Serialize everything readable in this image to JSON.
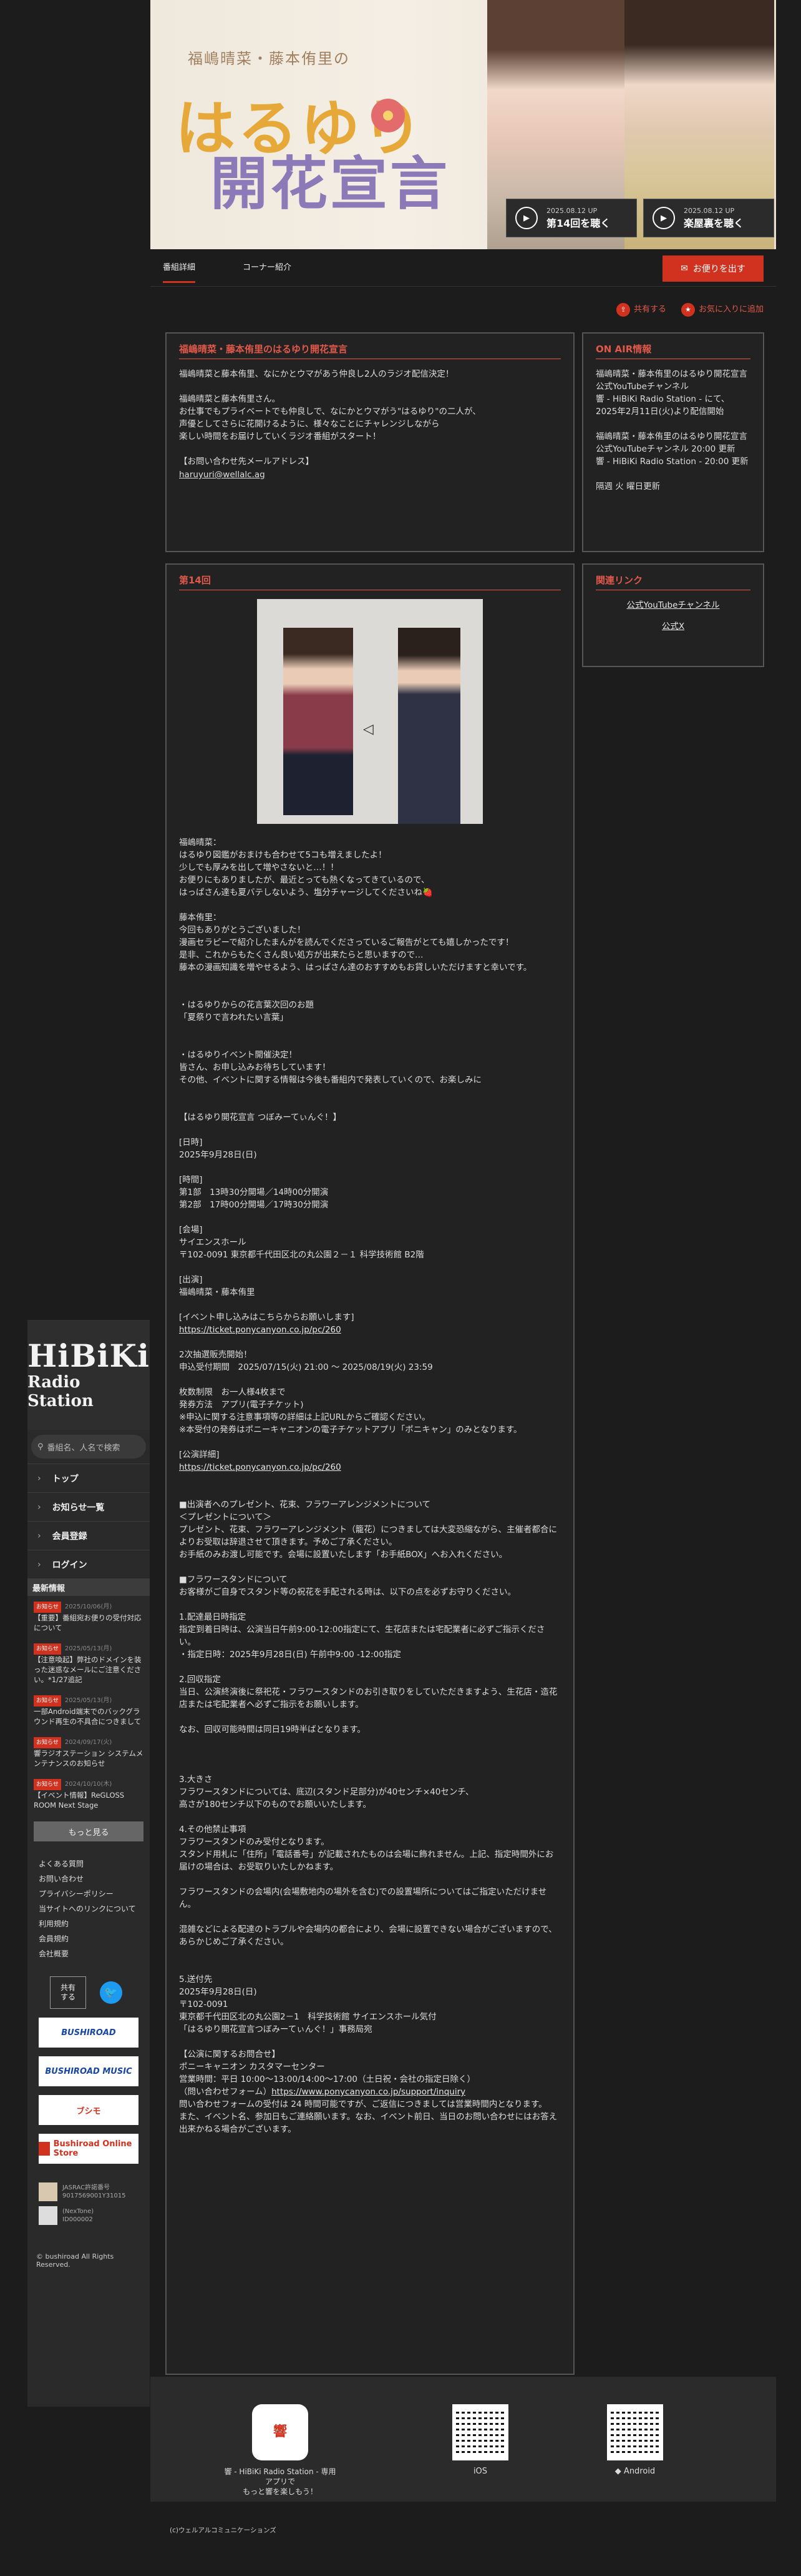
{
  "sidebar": {
    "logo_line1": "HiBiKi",
    "logo_line2": "Radio Station",
    "search_placeholder": "番組名、人名で検索",
    "nav": [
      {
        "label": "トップ"
      },
      {
        "label": "お知らせ一覧"
      },
      {
        "label": "会員登録"
      },
      {
        "label": "ログイン"
      }
    ],
    "news_heading": "最新情報",
    "news": [
      {
        "badge": "お知らせ",
        "date": "2025/10/06(月)",
        "text": "【重要】番組宛お便りの受付対応について"
      },
      {
        "badge": "お知らせ",
        "date": "2025/05/13(月)",
        "text": "【注意喚起】弊社のドメインを装った迷惑なメールにご注意ください。*1/27追記"
      },
      {
        "badge": "お知らせ",
        "date": "2025/05/13(月)",
        "text": "一部Android端末でのバックグラウンド再生の不具合につきまして"
      },
      {
        "badge": "お知らせ",
        "date": "2024/09/17(火)",
        "text": "響ラジオステーション システムメンテナンスのお知らせ"
      },
      {
        "badge": "お知らせ",
        "date": "2024/10/10(木)",
        "text": "【イベント情報】ReGLOSS ROOM Next Stage"
      }
    ],
    "more_label": "もっと見る",
    "links": [
      "よくある質問",
      "お問い合わせ",
      "プライバシーポリシー",
      "当サイトへのリンクについて",
      "利用規約",
      "会員規約",
      "会社概要"
    ],
    "share_label": "共有\nする",
    "twitter_glyph": "🐦",
    "banners": [
      "BUSHIROAD",
      "BUSHIROAD MUSIC",
      "ブシモ",
      "Bushiroad Online Store"
    ],
    "jasrac_text": "JASRAC許諾番号\n9017569001Y31015",
    "nextone_text": "(NexTone)\nID000002",
    "copyright": "© bushiroad All Rights Reserved."
  },
  "hero": {
    "subtitle": "福嶋晴菜・藤本侑里の",
    "title_line1": "はるゆり",
    "title_line2": "開花宣言",
    "buttons": [
      {
        "date": "2025.08.12 UP",
        "label": "第14回を聴く"
      },
      {
        "date": "2025.08.12 UP",
        "label": "楽屋裏を聴く"
      }
    ]
  },
  "tabs": {
    "items": [
      "番組詳細",
      "コーナー紹介"
    ],
    "letter_button": "お便りを出す"
  },
  "actions": {
    "share": "共有する",
    "favorite": "お気に入りに追加"
  },
  "intro": {
    "heading": "福嶋晴菜・藤本侑里のはるゆり開花宣言",
    "body": "福嶋晴菜と藤本侑里、なにかとウマがあう仲良し2人のラジオ配信決定！\n\n福嶋晴菜と藤本侑里さん。\nお仕事でもプライベートでも仲良しで、なにかとウマがう\"はるゆり\"の二人が、\n声優としてさらに花開けるように、様々なことにチャレンジしながら\n楽しい時間をお届けしていくラジオ番組がスタート！\n\n【お問い合わせ先メールアドレス】",
    "email": "haruyuri@wellalc.ag"
  },
  "onair": {
    "heading": "ON AIR情報",
    "body": "福嶋晴菜・藤本侑里のはるゆり開花宣言公式YouTubeチャンネル\n響 - HiBiKi Radio Station - にて、\n2025年2月11日(火)より配信開始\n\n福嶋晴菜・藤本侑里のはるゆり開花宣言公式YouTubeチャンネル 20:00 更新\n響 - HiBiKi Radio Station - 20:00 更新\n\n隔週 火 曜日更新"
  },
  "related": {
    "heading": "関連リンク",
    "links": [
      "公式YouTubeチャンネル",
      "公式X"
    ]
  },
  "episode": {
    "heading": "第14回",
    "text": "福嶋晴菜：\nはるゆり図鑑がおまけも合わせて5コも増えましたよ！\n少しでも厚みを出して増やさないと…！！\nお便りにもありましたが、最近とっても熱くなってきているので、\nはっぱさん達も夏バテしないよう、塩分チャージしてくださいね🍓\n\n藤本侑里：\n今回もありがとうございました！\n漫画セラピーで紹介したまんがを読んでくださっているご報告がとても嬉しかったです！\n是非、これからもたくさん良い処方が出来たらと思いますので…\n藤本の漫画知識を増やせるよう、はっぱさん達のおすすめもお貸しいただけますと幸いです。\n\n\n・はるゆりからの花言葉次回のお題\n「夏祭りで言われたい言葉」\n\n\n・はるゆりイベント開催決定！\n皆さん、お申し込みお待ちしています！\nその他、イベントに関する情報は今後も番組内で発表していくので、お楽しみに\n\n\n【はるゆり開花宣言 つぼみーてぃんぐ！】\n\n[日時]\n2025年9月28日(日)\n\n[時間]\n第1部　13時30分開場／14時00分開演\n第2部　17時00分開場／17時30分開演\n\n[会場]\nサイエンスホール\n〒102-0091 東京都千代田区北の丸公園２－１ 科学技術館 B2階\n\n[出演]\n福嶋晴菜・藤本侑里\n\n[イベント申し込みはこちらからお願いします]\n",
    "link1": "https://ticket.ponycanyon.co.jp/pc/260",
    "text2": "\n\n2次抽選販売開始！\n申込受付期間　2025/07/15(火) 21:00 ～ 2025/08/19(火) 23:59\n\n枚数制限　お一人様4枚まで\n発券方法　アプリ(電子チケット)\n※申込に関する注意事項等の詳細は上記URLからご確認ください。\n※本受付の発券はポニーキャニオンの電子チケットアプリ「ポニキャン」のみとなります。\n\n[公演詳細]\n",
    "link2": "https://ticket.ponycanyon.co.jp/pc/260",
    "text3": "\n\n\n■出演者へのプレゼント、花束、フラワーアレンジメントについて\n＜プレゼントについて＞\nプレゼント、花束、フラワーアレンジメント（籠花）につきましては大変恐縮ながら、主催者都合によりお受取は辞退させて頂きます。予めご了承ください。\nお手紙のみお渡し可能です。会場に設置いたします「お手紙BOX」へお入れください。\n\n■フラワースタンドについて\nお客様がご自身でスタンド等の祝花を手配される時は、以下の点を必ずお守りください。\n\n1.配達最日時指定\n指定到着日時は、公演当日午前9:00-12:00指定にて、生花店または宅配業者に必ずご指示ください。\n・指定日時：2025年9月28日(日) 午前中9:00 -12:00指定\n\n2.回収指定\n当日、公演終演後に祭祀花・フラワースタンドのお引き取りをしていただきますよう、生花店・造花店または宅配業者へ必ずご指示をお願いします。\n\nなお、回収可能時間は同日19時半ばとなります。\n\n\n\n3.大きさ\nフラワースタンドについては、底辺(スタンド足部分)が40センチ×40センチ、\n高さが180センチ以下のものでお願いいたします。\n\n4.その他禁止事項\nフラワースタンドのみ受付となります。\nスタンド用札に「住所」「電話番号」が記載されたものは会場に飾れません。上記、指定時間外にお届けの場合は、お受取りいたしかねます。\n\nフラワースタンドの会場内(会場敷地内の場外を含む)での設置場所についてはご指定いただけません。\n\n混雑などによる配達のトラブルや会場内の都合により、会場に設置できない場合がございますので、あらかじめご了承ください。\n\n\n5.送付先\n2025年9月28日(日)\n〒102-0091\n東京都千代田区北の丸公園2－1　科学技術館 サイエンスホール気付\n「はるゆり開花宣言つぼみーてぃんぐ！」事務局宛\n\n【公演に関するお問合せ】\nポニーキャニオン カスタマーセンター\n営業時間：平日 10:00～13:00/14:00～17:00（土日祝・会社の指定日除く）\n（問い合わせフォーム）",
    "link3": "https://www.ponycanyon.co.jp/support/inquiry",
    "text4": "\n問い合わせフォームの受付は 24 時間可能ですが、ご返信につきましては営業時間内となります。\nまた、イベント名、参加日もご連絡願います。なお、イベント前日、当日のお問い合わせにはお答え出来かねる場合がございます。"
  },
  "footer": {
    "app_icon_text": "響",
    "app_caption": "響 - HiBiKi Radio Station - 専用アプリで\nもっと響を楽しもう！",
    "ios_label": " iOS",
    "android_label": "◆ Android",
    "bottom_copyright": "(c)ウェルアルコミュニケーションズ"
  }
}
